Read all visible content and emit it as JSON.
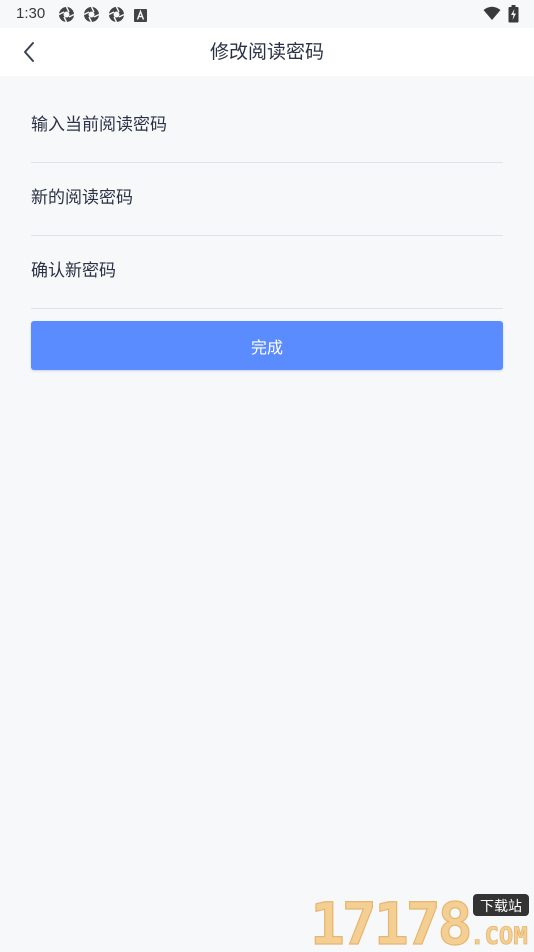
{
  "status_bar": {
    "time": "1:30",
    "icons": [
      "aperture-icon",
      "aperture-icon",
      "aperture-icon",
      "keyboard-a-icon",
      "wifi-icon",
      "battery-charging-icon"
    ]
  },
  "header": {
    "back_icon": "chevron-left-icon",
    "title": "修改阅读密码"
  },
  "form": {
    "current_password": {
      "value": "",
      "placeholder": "输入当前阅读密码"
    },
    "new_password": {
      "value": "",
      "placeholder": "新的阅读密码"
    },
    "confirm_password": {
      "value": "",
      "placeholder": "确认新密码"
    },
    "submit_label": "完成"
  },
  "colors": {
    "primary": "#5b8cff",
    "background": "#f7f8fa",
    "header_bg": "#ffffff",
    "text": "#2b3245",
    "divider": "#dfe2e8"
  },
  "watermark": {
    "main": "17178",
    "badge": "下载站",
    "suffix": ".COM"
  }
}
